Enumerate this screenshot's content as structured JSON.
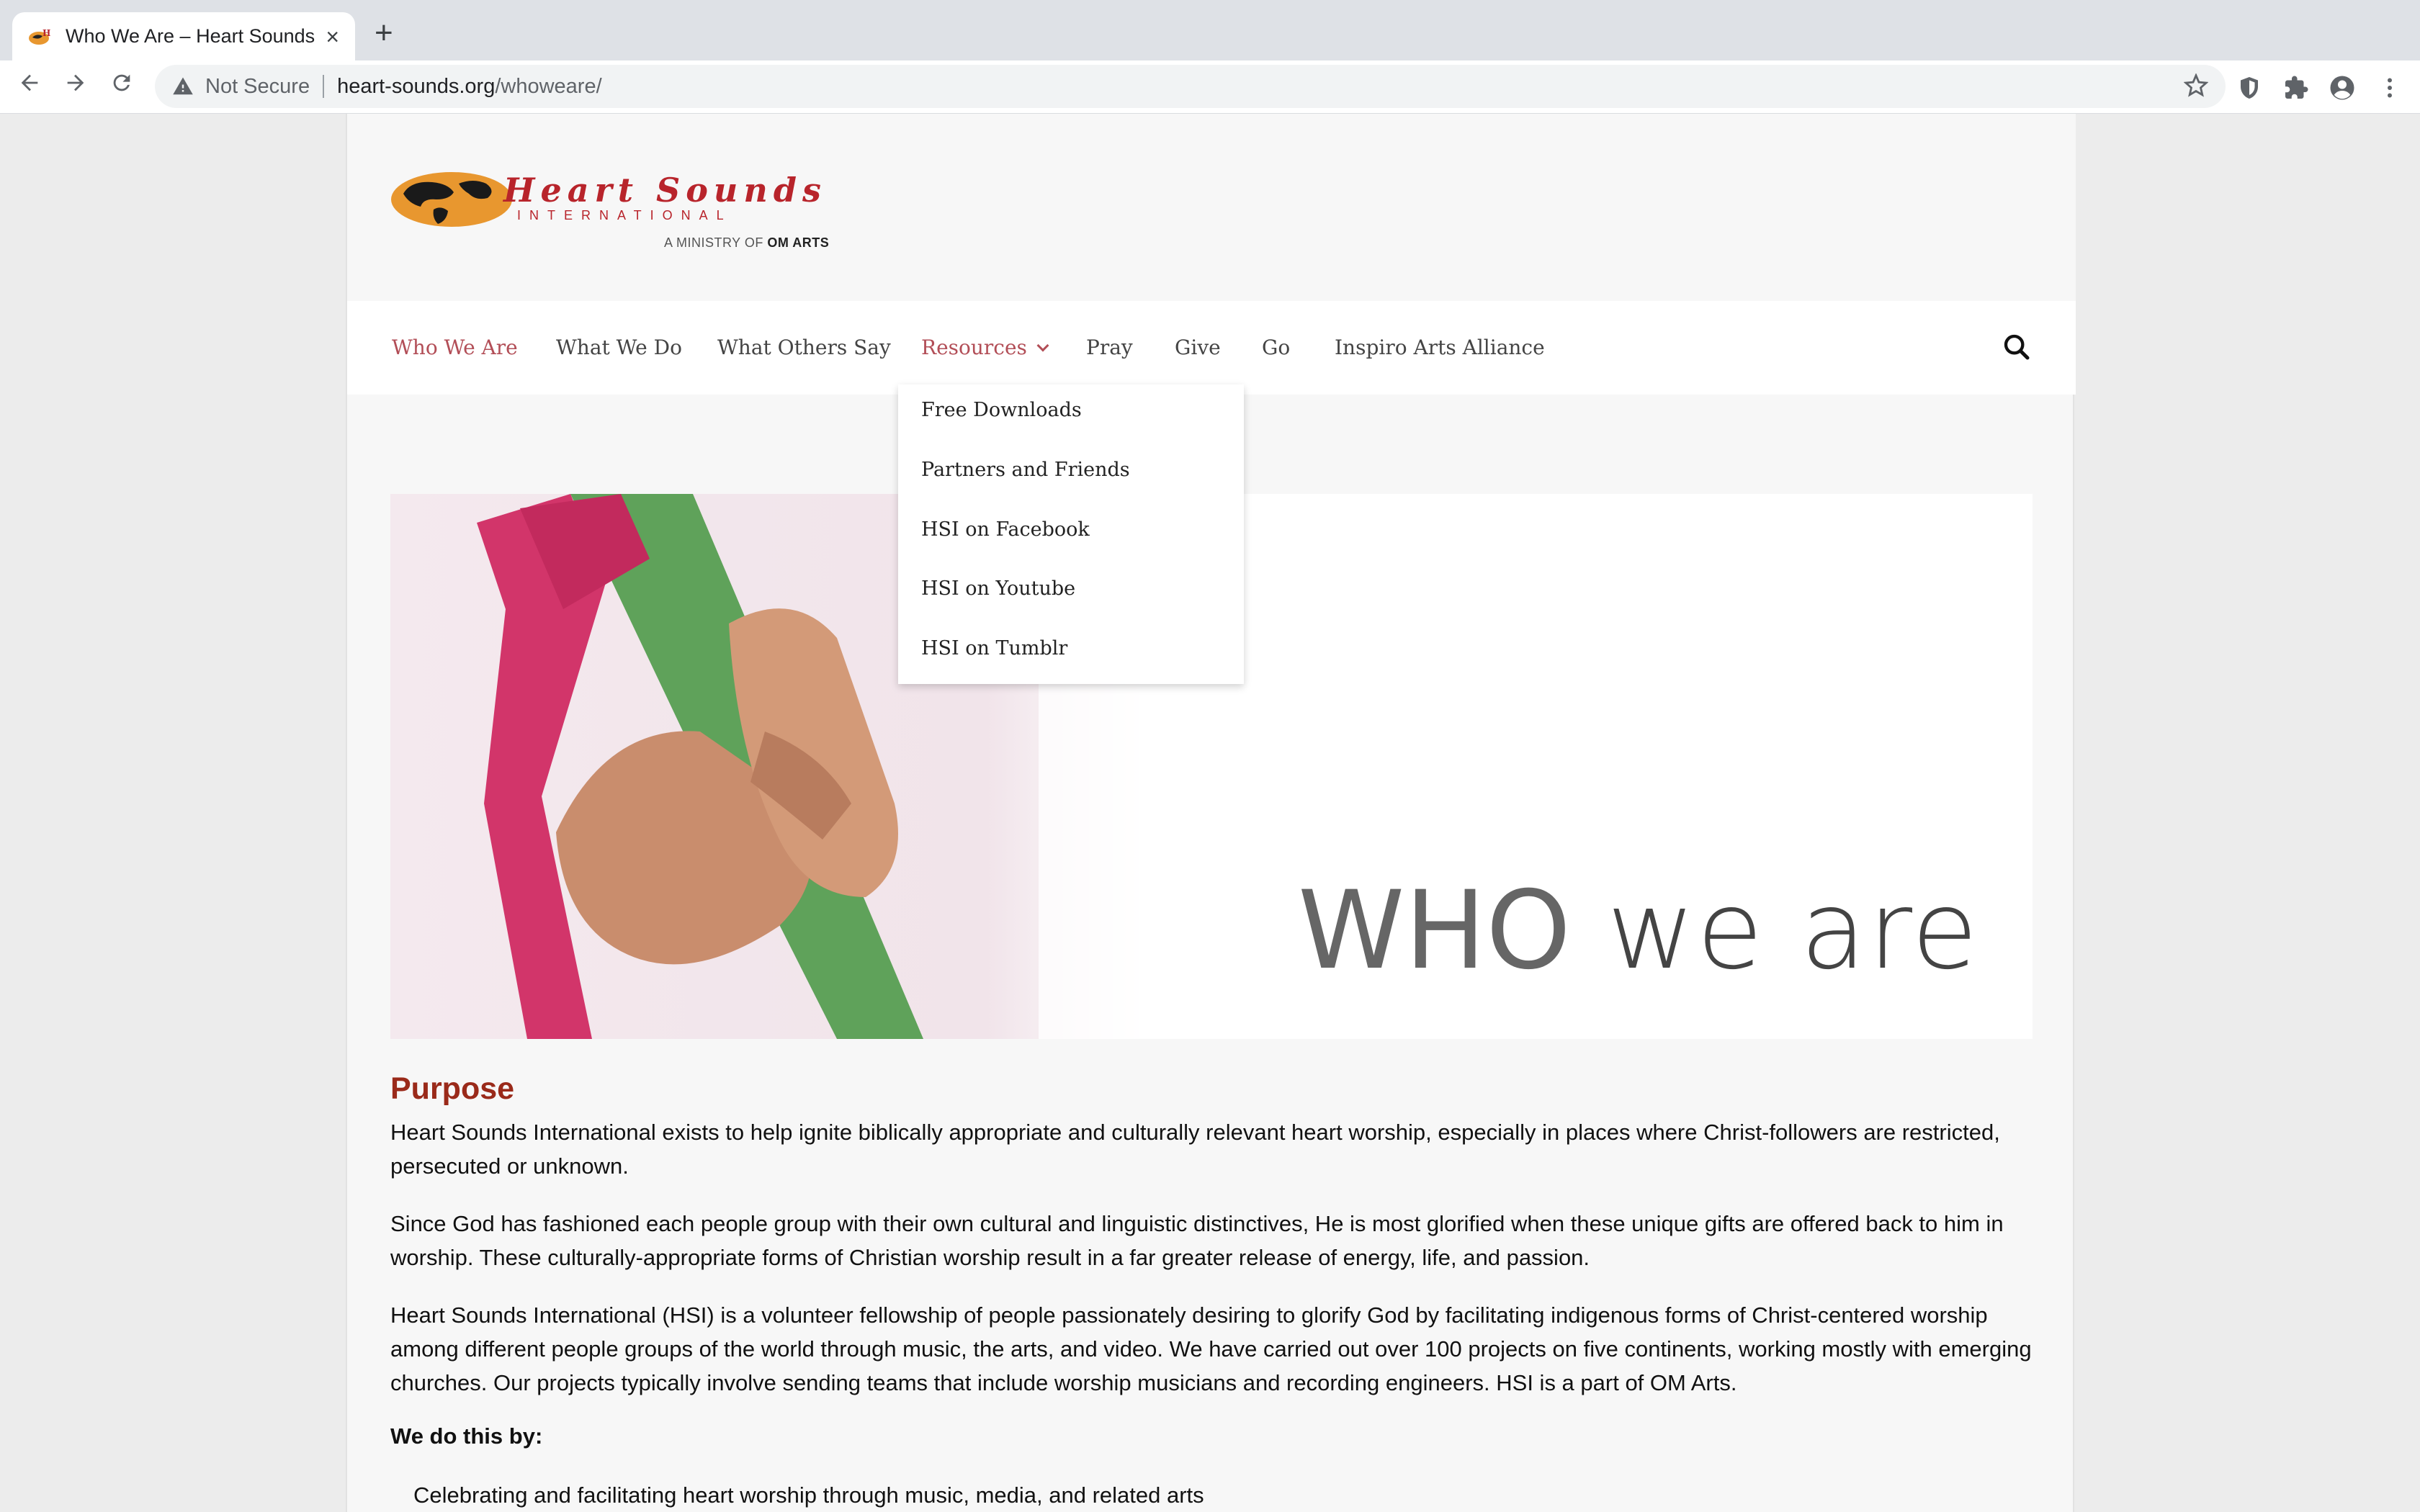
{
  "browser": {
    "tab_title": "Who We Are – Heart Sounds International",
    "new_tab": "+",
    "close": "×",
    "security_label": "Not Secure",
    "url_host": "heart-sounds.org",
    "url_path": "/whoweare/"
  },
  "logo": {
    "title": "Heart Sounds",
    "subtitle": "INTERNATIONAL",
    "tag_prefix": "A MINISTRY OF ",
    "tag_org": "OM ARTS"
  },
  "nav": {
    "items": [
      "Who We Are",
      "What We Do",
      "What Others Say",
      "Resources",
      "Pray",
      "Give",
      "Go",
      "Inspiro Arts Alliance"
    ],
    "active": "Who We Are"
  },
  "dropdown": {
    "items": [
      "Free Downloads",
      "Partners and Friends",
      "HSI on Facebook",
      "HSI on Youtube",
      "HSI on Tumblr"
    ]
  },
  "hero": {
    "text_a": "WHO",
    "text_b": "we are"
  },
  "content": {
    "heading": "Purpose",
    "paragraphs": [
      "Heart Sounds International exists to help ignite biblically appropriate and culturally relevant heart worship, especially in places where Christ-followers are restricted, persecuted or unknown.",
      "Since God has fashioned each people group with their own cultural and linguistic distinctives, He is most glorified when these unique gifts are offered back to him in worship. These culturally-appropriate forms of Christian worship result in a far greater release of energy, life, and passion.",
      "Heart Sounds International (HSI) is a volunteer fellowship of people passionately desiring to glorify God by facilitating indigenous forms of Christ-centered worship among different people groups of the world through music, the arts, and video. We have carried out over 100 projects on five continents, working mostly with emerging churches. Our projects typically involve sending teams that include worship musicians and recording engineers. HSI is a part of OM Arts."
    ],
    "we_do": "We do this by:",
    "list": [
      "Celebrating and facilitating heart worship through music, media, and related arts"
    ]
  },
  "colors": {
    "accent": "#b24e57",
    "heading": "#9a2a1a",
    "logo_red": "#b8242b",
    "logo_orange": "#e8972f"
  }
}
